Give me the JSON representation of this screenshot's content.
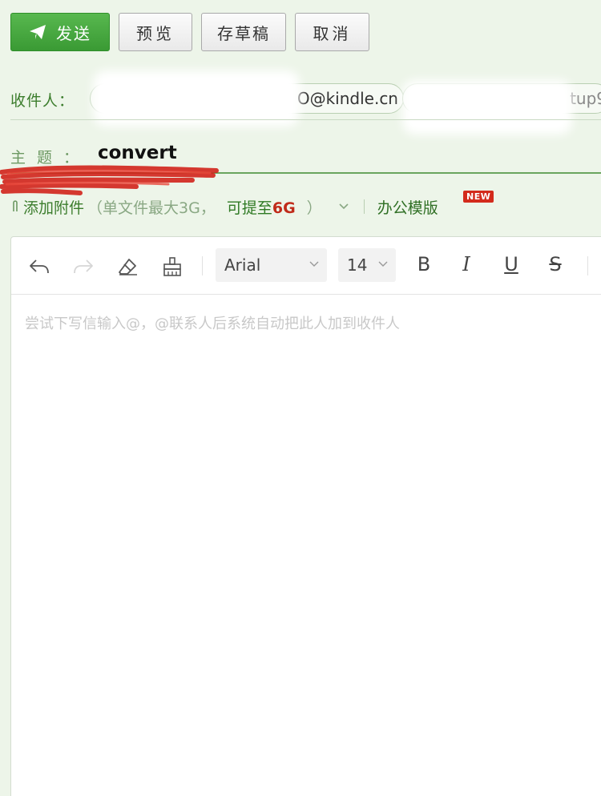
{
  "toolbar": {
    "send_label": "发送",
    "preview_label": "预览",
    "draft_label": "存草稿",
    "cancel_label": "取消"
  },
  "recipients": {
    "label": "收件人：",
    "chip1_visible_text": "O@kindle.cn",
    "chip2_visible_text": "tup9"
  },
  "subject": {
    "label": "主题：",
    "value": "convert"
  },
  "attachment": {
    "add_label": "添加附件",
    "limit_text": "（单文件最大3G，",
    "upgrade_text": "可提至",
    "upgrade_size": "6G",
    "close_paren": "）",
    "template_label": "办公模版",
    "new_badge": "NEW"
  },
  "editor": {
    "font_family": "Arial",
    "font_size": "14",
    "bold_label": "B",
    "italic_label": "I",
    "underline_label": "U",
    "strike_label": "S",
    "placeholder": "尝试下写信输入@，@联系人后系统自动把此人加到收件人"
  },
  "colors": {
    "accent_green": "#3a9a34",
    "label_green": "#3c7d2d",
    "badge_red": "#d32b1c"
  }
}
